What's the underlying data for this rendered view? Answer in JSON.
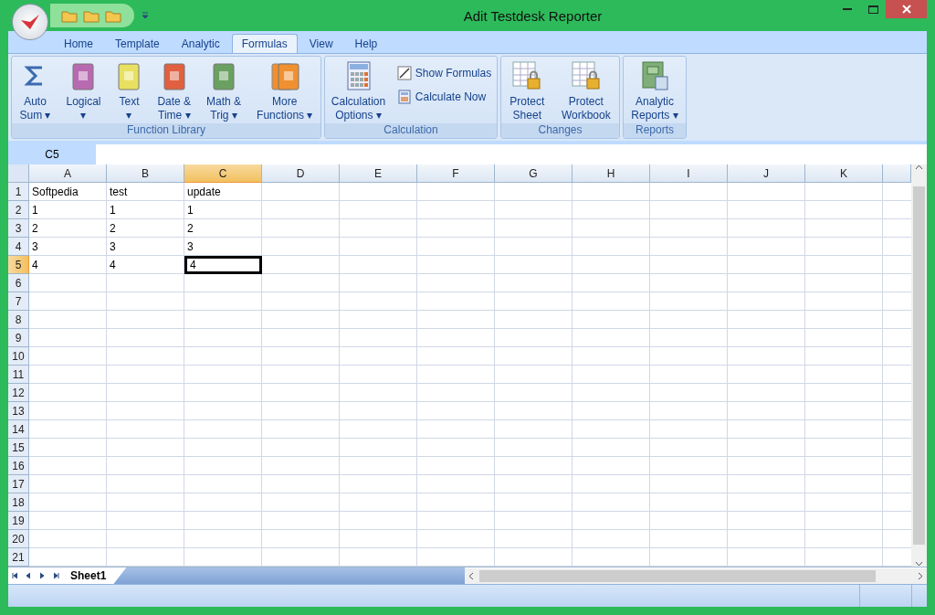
{
  "window": {
    "title": "Adit Testdesk Reporter"
  },
  "tabs": [
    {
      "label": "Home",
      "selected": false
    },
    {
      "label": "Template",
      "selected": false
    },
    {
      "label": "Analytic",
      "selected": false
    },
    {
      "label": "Formulas",
      "selected": true
    },
    {
      "label": "View",
      "selected": false
    },
    {
      "label": "Help",
      "selected": false
    }
  ],
  "ribbon_groups": [
    {
      "title": "Function Library",
      "buttons": [
        {
          "kind": "sigma",
          "lines": [
            "Auto",
            "Sum ▾"
          ]
        },
        {
          "kind": "book",
          "color": "#b86ab0",
          "lines": [
            "Logical",
            "▾"
          ]
        },
        {
          "kind": "book",
          "color": "#e8e060",
          "lines": [
            "Text",
            "▾"
          ]
        },
        {
          "kind": "book",
          "color": "#e06040",
          "lines": [
            "Date &",
            "Time ▾"
          ]
        },
        {
          "kind": "book",
          "color": "#6aa060",
          "lines": [
            "Math &",
            "Trig ▾"
          ]
        },
        {
          "kind": "books",
          "color": "#f09030",
          "lines": [
            "More",
            "Functions ▾"
          ]
        }
      ]
    },
    {
      "title": "Calculation",
      "buttons": [
        {
          "kind": "calc",
          "lines": [
            "Calculation",
            "Options ▾"
          ]
        },
        {
          "kind": "small",
          "items": [
            {
              "label": "Show Formulas"
            },
            {
              "label": "Calculate Now"
            }
          ]
        }
      ]
    },
    {
      "title": "Changes",
      "buttons": [
        {
          "kind": "protect",
          "lines": [
            "Protect",
            "Sheet"
          ]
        },
        {
          "kind": "protect",
          "lines": [
            "Protect",
            "Workbook"
          ]
        }
      ]
    },
    {
      "title": "Reports",
      "buttons": [
        {
          "kind": "report",
          "lines": [
            "Analytic",
            "Reports ▾"
          ]
        }
      ]
    }
  ],
  "name_box": "C5",
  "columns": [
    {
      "label": "A",
      "selected": false
    },
    {
      "label": "B",
      "selected": false
    },
    {
      "label": "C",
      "selected": true
    },
    {
      "label": "D",
      "selected": false
    },
    {
      "label": "E",
      "selected": false
    },
    {
      "label": "F",
      "selected": false
    },
    {
      "label": "G",
      "selected": false
    },
    {
      "label": "H",
      "selected": false
    },
    {
      "label": "I",
      "selected": false
    },
    {
      "label": "J",
      "selected": false
    },
    {
      "label": "K",
      "selected": false
    }
  ],
  "rows": [
    {
      "label": "1",
      "selected": false,
      "cells": [
        {
          "text": "Softpedia",
          "selected": false
        },
        {
          "text": "test",
          "selected": false
        },
        {
          "text": "update",
          "selected": false
        }
      ]
    },
    {
      "label": "2",
      "selected": false,
      "cells": [
        {
          "text": "1",
          "selected": false
        },
        {
          "text": "1",
          "selected": false
        },
        {
          "text": "1",
          "selected": false
        }
      ]
    },
    {
      "label": "3",
      "selected": false,
      "cells": [
        {
          "text": "2",
          "selected": false
        },
        {
          "text": "2",
          "selected": false
        },
        {
          "text": "2",
          "selected": false
        }
      ]
    },
    {
      "label": "4",
      "selected": false,
      "cells": [
        {
          "text": "3",
          "selected": false
        },
        {
          "text": "3",
          "selected": false
        },
        {
          "text": "3",
          "selected": false
        }
      ]
    },
    {
      "label": "5",
      "selected": true,
      "cells": [
        {
          "text": "4",
          "selected": false
        },
        {
          "text": "4",
          "selected": false
        },
        {
          "text": "4",
          "selected": true
        }
      ]
    },
    {
      "label": "6",
      "selected": false
    },
    {
      "label": "7",
      "selected": false
    },
    {
      "label": "8",
      "selected": false
    },
    {
      "label": "9",
      "selected": false
    },
    {
      "label": "10",
      "selected": false
    },
    {
      "label": "11",
      "selected": false
    },
    {
      "label": "12",
      "selected": false
    },
    {
      "label": "13",
      "selected": false
    },
    {
      "label": "14",
      "selected": false
    },
    {
      "label": "15",
      "selected": false
    },
    {
      "label": "16",
      "selected": false
    },
    {
      "label": "17",
      "selected": false
    },
    {
      "label": "18",
      "selected": false
    },
    {
      "label": "19",
      "selected": false
    },
    {
      "label": "20",
      "selected": false
    },
    {
      "label": "21",
      "selected": false
    }
  ],
  "sheet_tabs": [
    {
      "label": "Sheet1",
      "selected": true
    }
  ]
}
